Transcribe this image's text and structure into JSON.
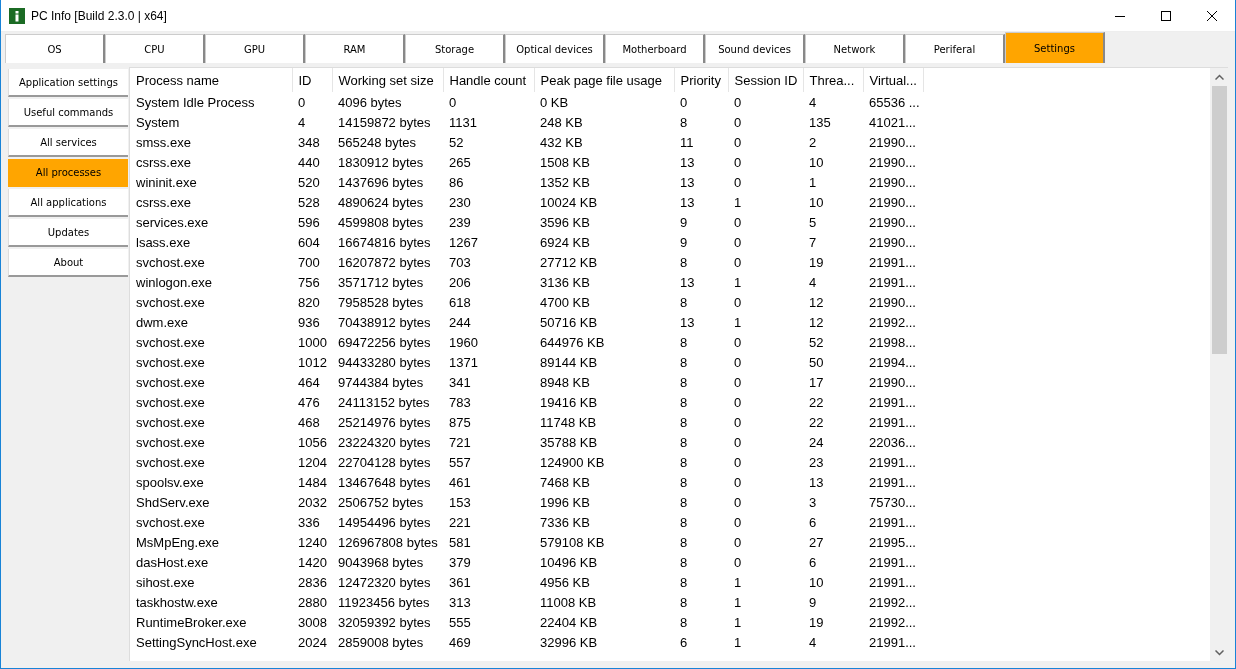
{
  "window": {
    "title": "PC Info [Build 2.3.0 | x64]"
  },
  "tabs": [
    {
      "label": "OS",
      "selected": false
    },
    {
      "label": "CPU",
      "selected": false
    },
    {
      "label": "GPU",
      "selected": false
    },
    {
      "label": "RAM",
      "selected": false
    },
    {
      "label": "Storage",
      "selected": false
    },
    {
      "label": "Optical devices",
      "selected": false
    },
    {
      "label": "Motherboard",
      "selected": false
    },
    {
      "label": "Sound devices",
      "selected": false
    },
    {
      "label": "Network",
      "selected": false
    },
    {
      "label": "Periferal",
      "selected": false
    },
    {
      "label": "Settings",
      "selected": true
    }
  ],
  "sidebar": {
    "items": [
      {
        "label": "Application settings",
        "selected": false
      },
      {
        "label": "Useful commands",
        "selected": false
      },
      {
        "label": "All services",
        "selected": false
      },
      {
        "label": "All processes",
        "selected": true
      },
      {
        "label": "All applications",
        "selected": false
      },
      {
        "label": "Updates",
        "selected": false
      },
      {
        "label": "About",
        "selected": false
      }
    ]
  },
  "table": {
    "columns": [
      "Process name",
      "ID",
      "Working set size",
      "Handle count",
      "Peak page file usage",
      "Priority",
      "Session ID",
      "Threa...",
      "Virtual..."
    ],
    "rows": [
      [
        "System Idle Process",
        "0",
        "4096 bytes",
        "0",
        "0 KB",
        "0",
        "0",
        "4",
        "65536 ..."
      ],
      [
        "System",
        "4",
        "14159872 bytes",
        "1131",
        "248 KB",
        "8",
        "0",
        "135",
        "41021..."
      ],
      [
        "smss.exe",
        "348",
        "565248 bytes",
        "52",
        "432 KB",
        "11",
        "0",
        "2",
        "21990..."
      ],
      [
        "csrss.exe",
        "440",
        "1830912 bytes",
        "265",
        "1508 KB",
        "13",
        "0",
        "10",
        "21990..."
      ],
      [
        "wininit.exe",
        "520",
        "1437696 bytes",
        "86",
        "1352 KB",
        "13",
        "0",
        "1",
        "21990..."
      ],
      [
        "csrss.exe",
        "528",
        "4890624 bytes",
        "230",
        "10024 KB",
        "13",
        "1",
        "10",
        "21990..."
      ],
      [
        "services.exe",
        "596",
        "4599808 bytes",
        "239",
        "3596 KB",
        "9",
        "0",
        "5",
        "21990..."
      ],
      [
        "lsass.exe",
        "604",
        "16674816 bytes",
        "1267",
        "6924 KB",
        "9",
        "0",
        "7",
        "21990..."
      ],
      [
        "svchost.exe",
        "700",
        "16207872 bytes",
        "703",
        "27712 KB",
        "8",
        "0",
        "19",
        "21991..."
      ],
      [
        "winlogon.exe",
        "756",
        "3571712 bytes",
        "206",
        "3136 KB",
        "13",
        "1",
        "4",
        "21991..."
      ],
      [
        "svchost.exe",
        "820",
        "7958528 bytes",
        "618",
        "4700 KB",
        "8",
        "0",
        "12",
        "21990..."
      ],
      [
        "dwm.exe",
        "936",
        "70438912 bytes",
        "244",
        "50716 KB",
        "13",
        "1",
        "12",
        "21992..."
      ],
      [
        "svchost.exe",
        "1000",
        "69472256 bytes",
        "1960",
        "644976 KB",
        "8",
        "0",
        "52",
        "21998..."
      ],
      [
        "svchost.exe",
        "1012",
        "94433280 bytes",
        "1371",
        "89144 KB",
        "8",
        "0",
        "50",
        "21994..."
      ],
      [
        "svchost.exe",
        "464",
        "9744384 bytes",
        "341",
        "8948 KB",
        "8",
        "0",
        "17",
        "21990..."
      ],
      [
        "svchost.exe",
        "476",
        "24113152 bytes",
        "783",
        "19416 KB",
        "8",
        "0",
        "22",
        "21991..."
      ],
      [
        "svchost.exe",
        "468",
        "25214976 bytes",
        "875",
        "11748 KB",
        "8",
        "0",
        "22",
        "21991..."
      ],
      [
        "svchost.exe",
        "1056",
        "23224320 bytes",
        "721",
        "35788 KB",
        "8",
        "0",
        "24",
        "22036..."
      ],
      [
        "svchost.exe",
        "1204",
        "22704128 bytes",
        "557",
        "124900 KB",
        "8",
        "0",
        "23",
        "21991..."
      ],
      [
        "spoolsv.exe",
        "1484",
        "13467648 bytes",
        "461",
        "7468 KB",
        "8",
        "0",
        "13",
        "21991..."
      ],
      [
        "ShdServ.exe",
        "2032",
        "2506752 bytes",
        "153",
        "1996 KB",
        "8",
        "0",
        "3",
        "75730..."
      ],
      [
        "svchost.exe",
        "336",
        "14954496 bytes",
        "221",
        "7336 KB",
        "8",
        "0",
        "6",
        "21991..."
      ],
      [
        "MsMpEng.exe",
        "1240",
        "126967808 bytes",
        "581",
        "579108 KB",
        "8",
        "0",
        "27",
        "21995..."
      ],
      [
        "dasHost.exe",
        "1420",
        "9043968 bytes",
        "379",
        "10496 KB",
        "8",
        "0",
        "6",
        "21991..."
      ],
      [
        "sihost.exe",
        "2836",
        "12472320 bytes",
        "361",
        "4956 KB",
        "8",
        "1",
        "10",
        "21991..."
      ],
      [
        "taskhostw.exe",
        "2880",
        "11923456 bytes",
        "313",
        "11008 KB",
        "8",
        "1",
        "9",
        "21992..."
      ],
      [
        "RuntimeBroker.exe",
        "3008",
        "32059392 bytes",
        "555",
        "22404 KB",
        "8",
        "1",
        "19",
        "21992..."
      ],
      [
        "SettingSyncHost.exe",
        "2024",
        "2859008 bytes",
        "469",
        "32996 KB",
        "6",
        "1",
        "4",
        "21991..."
      ]
    ]
  }
}
